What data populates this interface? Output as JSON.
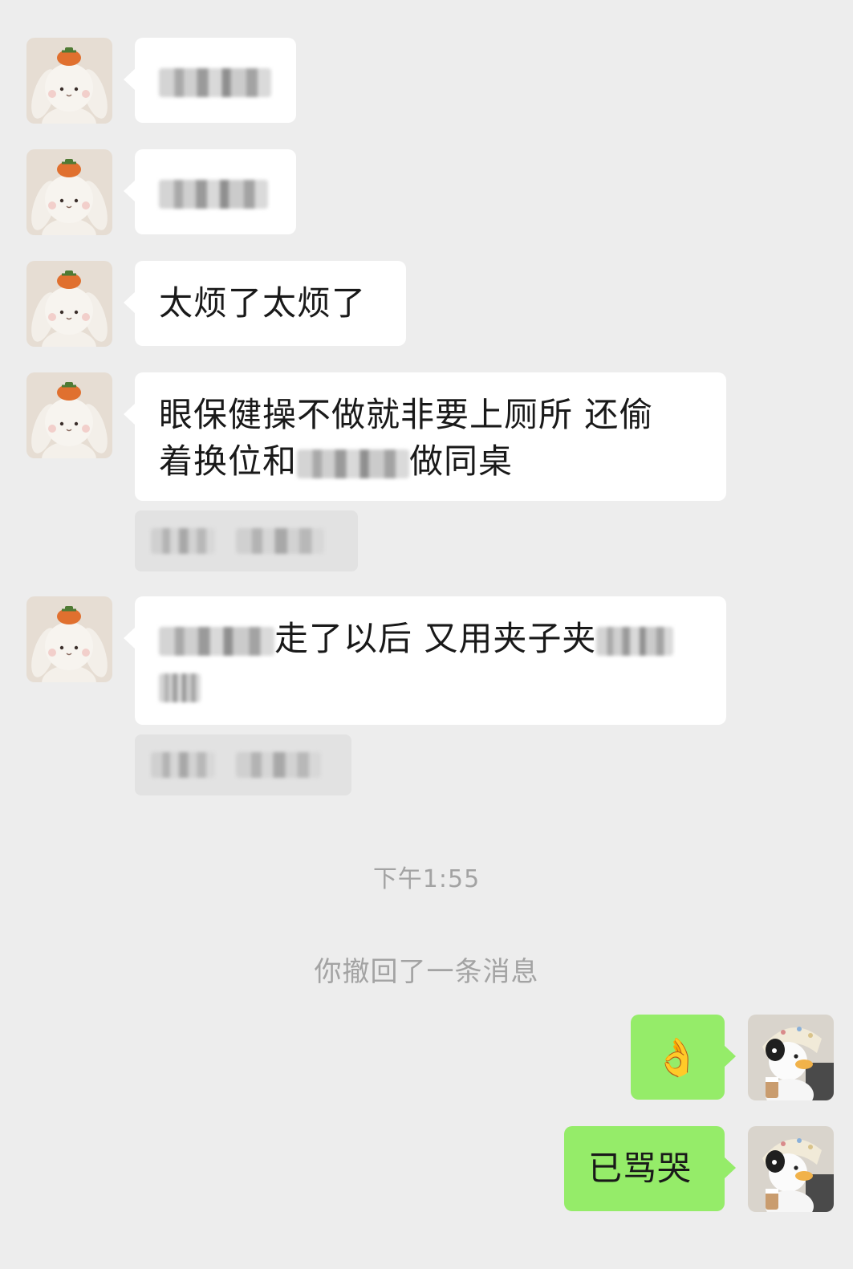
{
  "chat": {
    "messages": [
      {
        "id": "m1",
        "sender": "friend",
        "text": ""
      },
      {
        "id": "m2",
        "sender": "friend",
        "text": ""
      },
      {
        "id": "m3",
        "sender": "friend",
        "text": "太烦了太烦了"
      },
      {
        "id": "m4",
        "sender": "friend",
        "line1": "眼保健操不做就非要上厕所 还偷",
        "line2_a": "着换位和",
        "line2_b": "做同桌"
      },
      {
        "id": "m5",
        "sender": "friend",
        "text_a": "走了以后 又用夹子夹"
      },
      {
        "id": "m6",
        "sender": "me",
        "text": "👌"
      },
      {
        "id": "m7",
        "sender": "me",
        "text": "已骂哭"
      }
    ],
    "timestamp": "下午1:55",
    "recall_notice": "你撤回了一条消息"
  },
  "colors": {
    "background": "#ededed",
    "bubble_friend": "#ffffff",
    "bubble_me": "#95ec69",
    "system_text": "#a3a3a3"
  },
  "icons": {
    "friend_avatar": "bunny-with-persimmon-avatar",
    "my_avatar": "duck-with-headscarf-avatar"
  }
}
